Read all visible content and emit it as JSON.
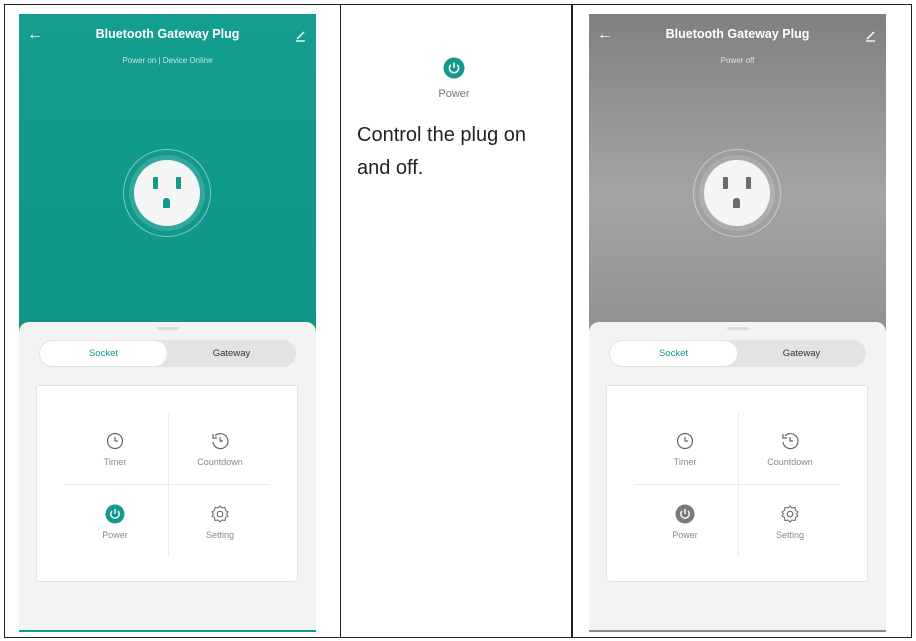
{
  "left_phone": {
    "title": "Bluetooth Gateway Plug",
    "status": "Power on | Device Online",
    "tabs": [
      "Socket",
      "Gateway"
    ],
    "tiles": [
      "Timer",
      "Countdown",
      "Power",
      "Setting"
    ],
    "accent": "#12998b",
    "power_state": "on"
  },
  "right_phone": {
    "title": "Bluetooth Gateway Plug",
    "status": "Power off",
    "tabs": [
      "Socket",
      "Gateway"
    ],
    "tiles": [
      "Timer",
      "Countdown",
      "Power",
      "Setting"
    ],
    "accent": "#7a7a7a",
    "power_state": "off"
  },
  "middle": {
    "icon_label": "Power",
    "description": "Control the plug on and off."
  },
  "icons": {
    "back": "arrow-left-icon",
    "edit": "pencil-icon",
    "timer": "clock-icon",
    "countdown": "countdown-icon",
    "power": "power-icon",
    "setting": "gear-icon"
  }
}
